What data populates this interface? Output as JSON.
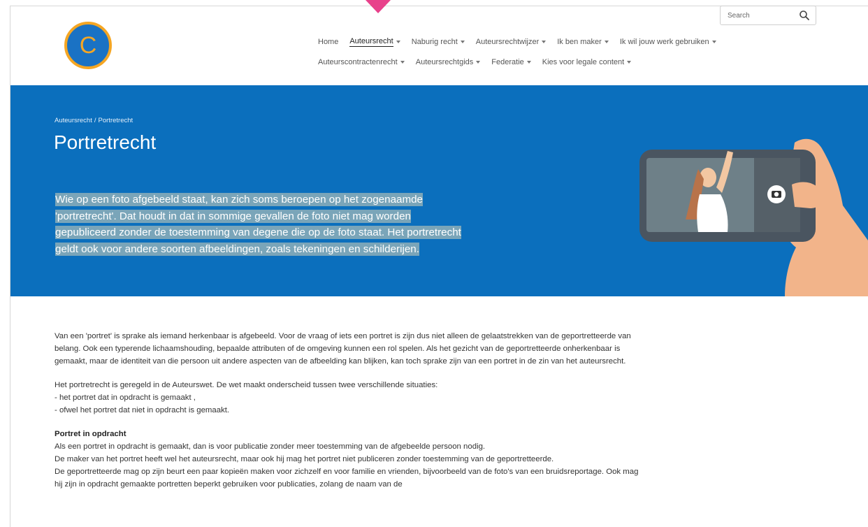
{
  "search": {
    "placeholder": "Search"
  },
  "logo": {
    "letter": "C"
  },
  "nav": {
    "row1": [
      {
        "label": "Home",
        "dropdown": false,
        "active": false
      },
      {
        "label": "Auteursrecht",
        "dropdown": true,
        "active": true
      },
      {
        "label": "Naburig recht",
        "dropdown": true,
        "active": false
      },
      {
        "label": "Auteursrechtwijzer",
        "dropdown": true,
        "active": false
      },
      {
        "label": "Ik ben maker",
        "dropdown": true,
        "active": false
      },
      {
        "label": "Ik wil jouw werk gebruiken",
        "dropdown": true,
        "active": false
      }
    ],
    "row2": [
      {
        "label": "Auteurscontractenrecht",
        "dropdown": true,
        "active": false
      },
      {
        "label": "Auteursrechtgids",
        "dropdown": true,
        "active": false
      },
      {
        "label": "Federatie",
        "dropdown": true,
        "active": false
      },
      {
        "label": "Kies voor legale content",
        "dropdown": true,
        "active": false
      }
    ]
  },
  "hero": {
    "breadcrumb": {
      "parent": "Auteursrecht",
      "separator": "/",
      "current": "Portretrecht"
    },
    "title": "Portretrecht",
    "lead_lines": [
      "Wie op een foto afgebeeld staat, kan zich soms beroepen op het zogenaamde",
      "'portretrecht'. Dat houdt in dat in sommige gevallen de foto niet mag worden",
      "gepubliceerd zonder de toestemming van degene die op de foto staat. Het portretrecht",
      "geldt ook voor andere soorten afbeeldingen, zoals tekeningen en schilderijen."
    ]
  },
  "content": {
    "p1": "Van een 'portret' is sprake als iemand herkenbaar is afgebeeld. Voor de vraag of iets een portret is zijn dus niet alleen de gelaatstrekken van de geportretteerde van belang. Ook een typerende lichaamshouding, bepaalde attributen of de omgeving kunnen een rol spelen. Als het gezicht van de geportretteerde onherkenbaar is gemaakt, maar de identiteit van die persoon uit andere aspecten van de afbeelding kan blijken, kan toch sprake zijn van een portret in de zin van het auteursrecht.",
    "p2_intro": "Het portretrecht is geregeld in de Auteurswet. De wet maakt onderscheid tussen twee verschillende situaties:",
    "p2_item1": "- het portret dat in opdracht is gemaakt ,",
    "p2_item2": "- ofwel het portret dat niet in opdracht is gemaakt.",
    "h_opdracht": "Portret in opdracht",
    "p3a": "Als een portret in opdracht is gemaakt, dan is voor publicatie zonder meer toestemming van de afgebeelde persoon nodig.",
    "p3b": "De maker van het portret heeft wel het auteursrecht, maar ook hij mag het portret niet publiceren zonder toestemming van de geportretteerde.",
    "p3c": "De geportretteerde mag op zijn beurt een paar kopieën maken voor zichzelf en voor familie en vrienden, bijvoorbeeld van de foto's van een bruidsreportage. Ook mag hij zijn in opdracht gemaakte portretten beperkt gebruiken voor publicaties, zolang de naam van de"
  },
  "colors": {
    "hero_bg": "#0b6fbd",
    "highlight": "#7aa5b9",
    "logo_orange": "#f5a623",
    "logo_blue": "#1a72c4",
    "arrow_pink": "#e8418b"
  }
}
